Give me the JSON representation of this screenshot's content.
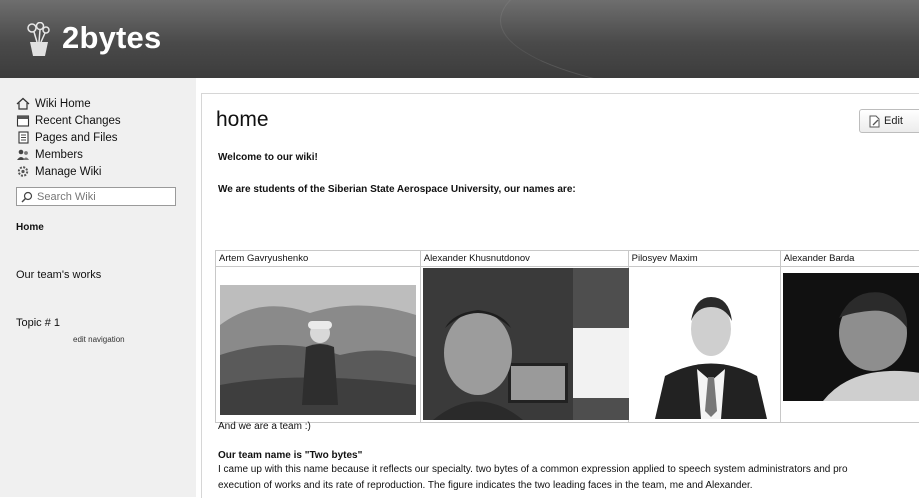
{
  "site": {
    "title": "2bytes"
  },
  "sidebar": {
    "nav_items": [
      {
        "label": "Wiki Home",
        "icon": "house-icon"
      },
      {
        "label": "Recent Changes",
        "icon": "calendar-icon"
      },
      {
        "label": "Pages and Files",
        "icon": "pages-icon"
      },
      {
        "label": "Members",
        "icon": "members-icon"
      },
      {
        "label": "Manage Wiki",
        "icon": "gear-icon"
      }
    ],
    "search_placeholder": "Search Wiki",
    "links": [
      {
        "label": "Home",
        "bold": true
      },
      {
        "label": "Our team's works"
      },
      {
        "label": "Topic # 1"
      }
    ],
    "edit_navigation": "edit navigation"
  },
  "content": {
    "title": "home",
    "edit_button": "Edit",
    "welcome": "Welcome to our wiki!",
    "intro": "We are students of the Siberian State Aerospace University, our names are:",
    "team_members": [
      "Artem Gavryushenko",
      "Alexander Khusnutdonov",
      "Pilosyev Maxim",
      "Alexander Barda"
    ],
    "team_line": "And we are a team :)",
    "team_name_heading": "Our team name is \"Two bytes\"",
    "paragraph_1": "I came up with this name because it reflects our specialty. two bytes of a common expression applied to speech system administrators and pro",
    "paragraph_2": "execution of works and its rate of reproduction. The figure indicates the two leading faces in the team, me and Alexander."
  }
}
